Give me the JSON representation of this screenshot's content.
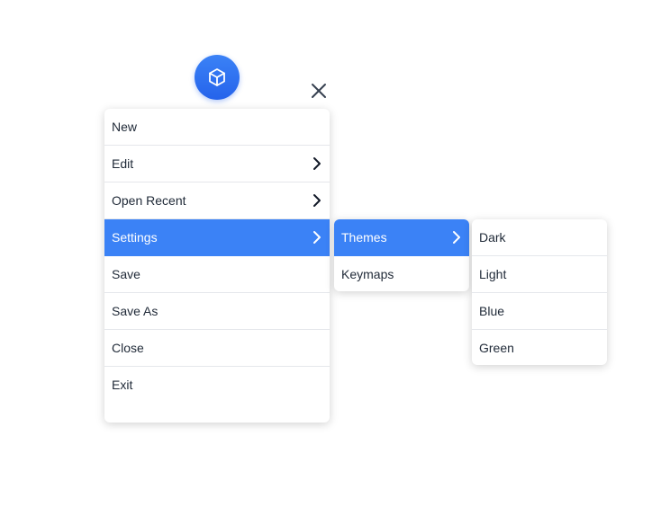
{
  "colors": {
    "accent": "#3b82f6",
    "icon_bg": "#2563eb",
    "text": "#1f2937",
    "divider": "#e5e7eb"
  },
  "app_icon": "cube-icon",
  "close_icon": "close-icon",
  "main_menu": {
    "items": [
      {
        "label": "New"
      },
      {
        "label": "Edit",
        "has_submenu": true
      },
      {
        "label": "Open Recent",
        "has_submenu": true
      },
      {
        "label": "Settings",
        "has_submenu": true,
        "active": true
      },
      {
        "label": "Save"
      },
      {
        "label": "Save As"
      },
      {
        "label": "Close"
      },
      {
        "label": "Exit"
      }
    ]
  },
  "settings_menu": {
    "items": [
      {
        "label": "Themes",
        "has_submenu": true,
        "active": true
      },
      {
        "label": "Keymaps"
      }
    ]
  },
  "themes_menu": {
    "items": [
      {
        "label": "Dark"
      },
      {
        "label": "Light"
      },
      {
        "label": "Blue"
      },
      {
        "label": "Green"
      }
    ]
  }
}
